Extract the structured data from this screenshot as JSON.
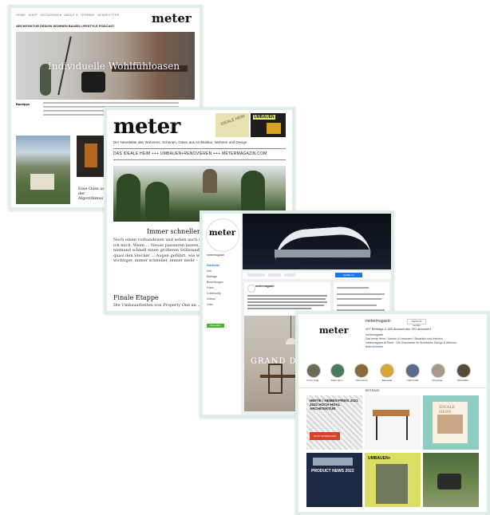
{
  "card1": {
    "top_nav": "HOME · SHOP · INSTAGRAM ▾ · ABOUT ▾ · TERMINE · NEWSLETTER",
    "logo": "meter",
    "main_nav": "ARCHITEKTUR   DESIGN   WOHNEN   BAUEN   LIFESTYLE   PODCAST",
    "hero_title": "Individuelle Wohlfühloasen",
    "section_label": "Bautipps",
    "teaser_title": "Eine Oase an der Algorithmus"
  },
  "card2": {
    "logo": "meter",
    "book1": "IDEALE HEIM",
    "book2": "UMBAUEN",
    "tagline": "Der Newsletter des Wohnens, Schönen, Guten aus Architektur, Wohnen und Design.",
    "links": "DAS IDEALE HEIM   +++   UMBAUEN+RENOVIEREN   +++   METERMAGAZIN.COM",
    "headline": "Immer schneller, immer...",
    "body": "Noch einen vorhandenen und sehen auch scheint ... starkes Licht – und darauf freue ich mich. Wenn ... Neuse passieren lassen, fast noch die Situation ... Neue hat niemand schnell einen größeren Stillstand ... wurde in vielen Ecken dieser Welt quasi den Stecker ... Augen geführt, wie wichtig mein Schauen und ... immer wichtiger, immer schneller, immer mehr – ... unseren Planeten wunderbar!",
    "signature": "Herzlichst, Ihr ...",
    "h2": "Finale Etappe",
    "h2_body": "Die Umbauarbeiten von Property One an ..."
  },
  "card3": {
    "profile_logo": "meter",
    "page_name": "metermagazin",
    "nav_items": [
      "Startseite",
      "Info",
      "Beiträge",
      "Bewertungen",
      "Fotos",
      "Community",
      "Videos",
      "Jobs"
    ],
    "promote_label": "Bewerben",
    "follow_button": "Gefällt mir",
    "post_author": "metermagazin",
    "post_image_text": "GRAND DE"
  },
  "card4": {
    "logo": "meter",
    "username": "metermagazin",
    "profile_button": "Nachricht senden",
    "stats": "497 Beiträge     2.185 Abonnenten     391 abonniert",
    "bio_line1": "metermagazin",
    "bio_line2": "Das beste Heim / Umbau & Umbauen / Baukultur und Interieur",
    "bio_line3": "metermagazin.at Rede · Die Geschichte für Architektur Design & Wohnen",
    "bio_link": "linktr.ee/meter",
    "highlights": [
      "Immo-Aufg...",
      "Daily Hom...",
      "Sale Home",
      "Baustelle",
      "maßTrends",
      "Innenlage...",
      "Wohnstilla..."
    ],
    "tab_label": "BEITRÄGE",
    "tile1_heading": "HEFTE / HEMEN PREIS 2021 2022 HOCH HOAL ARCHITEKTUR",
    "tile1_badge": "JETZT EINREICHEN",
    "tile3_label": "IDEALE HEIM",
    "tile4_label": "PRODUCT NEWS 2022",
    "tile5_label": "UMBAUEN+"
  }
}
